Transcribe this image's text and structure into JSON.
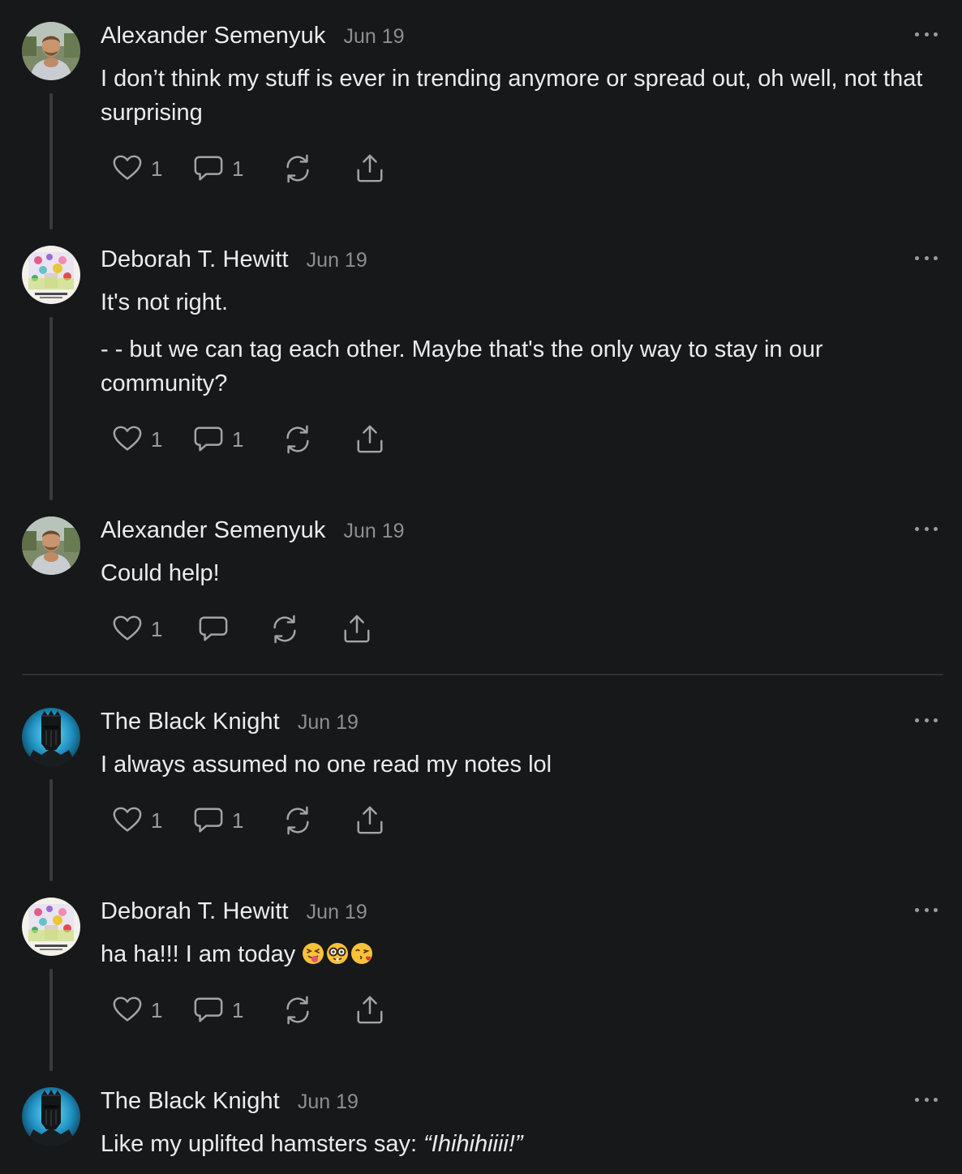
{
  "notes": [
    {
      "author": "Alexander Semenyuk",
      "date": "Jun 19",
      "paragraphs": [
        "I don’t think my stuff is ever in trending anymore or spread out, oh well, not that surprising"
      ],
      "likes": "1",
      "comments": "1",
      "avatar": "portrait-photo"
    },
    {
      "author": "Deborah T. Hewitt",
      "date": "Jun 19",
      "paragraphs": [
        "It's not right.",
        "- - but we can tag each other. Maybe that's the only way to stay in our community?"
      ],
      "likes": "1",
      "comments": "1",
      "avatar": "book-cover"
    },
    {
      "author": "Alexander Semenyuk",
      "date": "Jun 19",
      "paragraphs": [
        "Could help!"
      ],
      "likes": "1",
      "comments": "",
      "avatar": "portrait-photo"
    },
    {
      "author": "The Black Knight",
      "date": "Jun 19",
      "paragraphs": [
        "I always assumed no one read my notes lol"
      ],
      "likes": "1",
      "comments": "1",
      "avatar": "knight-helmet"
    },
    {
      "author": "Deborah T. Hewitt",
      "date": "Jun 19",
      "text_before_emoji": "ha ha!!! I am today ",
      "emojis": [
        "squinting-face-with-tongue",
        "nerd-face",
        "face-blowing-kiss"
      ],
      "likes": "1",
      "comments": "1",
      "avatar": "book-cover"
    },
    {
      "author": "The Black Knight",
      "date": "Jun 19",
      "text_prefix": "Like my uplifted hamsters say: ",
      "text_italic": "“Ihihihiiii!”",
      "avatar": "knight-helmet"
    }
  ],
  "icons": {
    "like": "heart-icon",
    "comment": "comment-bubble-icon",
    "restack": "restack-icon",
    "share": "share-icon",
    "more": "more-options-icon"
  },
  "colors": {
    "background": "#17181a",
    "text": "#ececec",
    "muted": "#8d8e92",
    "thread_line": "#3a3b3e"
  }
}
